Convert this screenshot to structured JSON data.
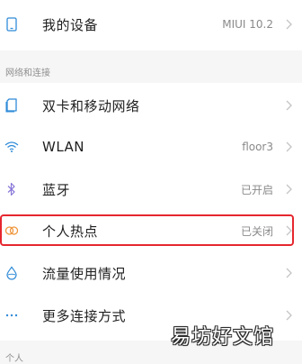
{
  "colors": {
    "icon_blue": "#2f8bd8",
    "icon_purple": "#8a78d8",
    "icon_orange": "#f0963c",
    "highlight_red": "#e6272f",
    "secondary_text": "#8a8a8a"
  },
  "rows": {
    "device": {
      "label": "我的设备",
      "value": "MIUI 10.2",
      "icon": "phone-icon"
    },
    "dual_sim": {
      "label": "双卡和移动网络",
      "icon": "sim-card-icon"
    },
    "wlan": {
      "label": "WLAN",
      "value": "floor3",
      "icon": "wifi-icon"
    },
    "bluetooth": {
      "label": "蓝牙",
      "value": "已开启",
      "icon": "bluetooth-icon"
    },
    "hotspot": {
      "label": "个人热点",
      "value": "已关闭",
      "icon": "hotspot-icon"
    },
    "data_usage": {
      "label": "流量使用情况",
      "icon": "water-drop-icon"
    },
    "more_connections": {
      "label": "更多连接方式",
      "icon": "more-dots-icon"
    }
  },
  "sections": {
    "network": "网络和连接",
    "personal": "个人"
  },
  "watermark": "易坊好文馆"
}
